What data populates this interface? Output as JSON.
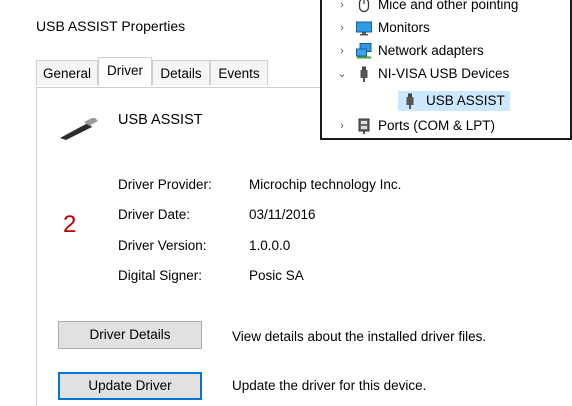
{
  "dialog": {
    "title": "USB ASSIST Properties",
    "tabs": [
      {
        "label": "General",
        "active": false
      },
      {
        "label": "Driver",
        "active": true
      },
      {
        "label": "Details",
        "active": false
      },
      {
        "label": "Events",
        "active": false
      }
    ],
    "device_name": "USB ASSIST",
    "fields": [
      {
        "label": "Driver Provider:",
        "value": "Microchip technology Inc."
      },
      {
        "label": "Driver Date:",
        "value": "03/11/2016"
      },
      {
        "label": "Driver Version:",
        "value": "1.0.0.0"
      },
      {
        "label": "Digital Signer:",
        "value": "Posic SA"
      }
    ],
    "buttons": [
      {
        "label": "Driver Details",
        "description": "View details about the installed driver files."
      },
      {
        "label": "Update Driver",
        "description": "Update the driver for this device."
      }
    ],
    "annotation_marker": "2"
  },
  "device_manager": {
    "items": [
      {
        "label": "Mice and other pointing",
        "chevron": "›",
        "icon": "mouse-icon"
      },
      {
        "label": "Monitors",
        "chevron": "›",
        "icon": "monitor-icon"
      },
      {
        "label": "Network adapters",
        "chevron": "›",
        "icon": "network-icon"
      },
      {
        "label": "NI-VISA USB Devices",
        "chevron": "⌄",
        "icon": "usb-icon"
      },
      {
        "label": "USB ASSIST",
        "chevron": "",
        "icon": "usb-icon",
        "selected": true
      },
      {
        "label": "Ports (COM & LPT)",
        "chevron": "›",
        "icon": "port-icon"
      }
    ]
  },
  "colors": {
    "selection": "#cce8ff",
    "marker": "#c00000",
    "focus": "#0078d7"
  }
}
